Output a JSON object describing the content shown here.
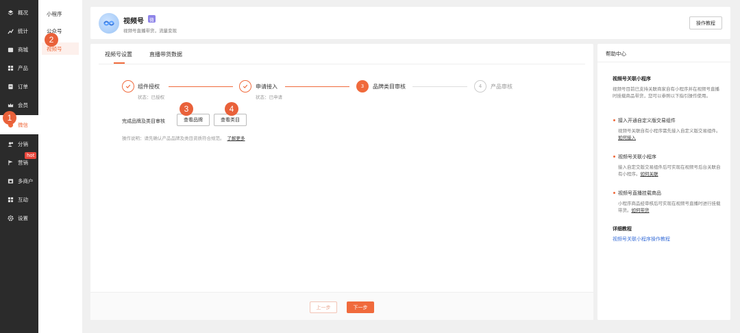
{
  "sidebar": {
    "items": [
      {
        "label": "概况",
        "icon": "layers-icon"
      },
      {
        "label": "统计",
        "icon": "chart-icon"
      },
      {
        "label": "商城",
        "icon": "store-icon"
      },
      {
        "label": "产品",
        "icon": "grid-icon"
      },
      {
        "label": "订单",
        "icon": "order-icon"
      },
      {
        "label": "会员",
        "icon": "crown-icon"
      },
      {
        "label": "微信",
        "icon": "wechat-icon"
      },
      {
        "label": "分销",
        "icon": "users-icon"
      },
      {
        "label": "营销",
        "icon": "flag-icon"
      },
      {
        "label": "多商户",
        "icon": "shop-icon"
      },
      {
        "label": "互动",
        "icon": "apps-icon"
      },
      {
        "label": "设置",
        "icon": "gear-icon"
      }
    ],
    "hot_badge": "hot",
    "accent": "#f06a3c"
  },
  "submenu": {
    "items": [
      {
        "label": "小程序"
      },
      {
        "label": "公众号"
      },
      {
        "label": "视频号"
      }
    ]
  },
  "annotations": [
    "1",
    "2",
    "3",
    "4"
  ],
  "header": {
    "title": "视频号",
    "tag": "微",
    "subtitle": "视频号直播带货，流量变现",
    "tutorial_button": "操作教程"
  },
  "tabs": [
    {
      "label": "视频号设置"
    },
    {
      "label": "直播带货数据"
    }
  ],
  "steps": [
    {
      "index": "1",
      "label": "组件授权",
      "status": "状态：已授权"
    },
    {
      "index": "2",
      "label": "申请接入",
      "status": "状态：已申请"
    },
    {
      "index": "3",
      "label": "品牌类目审核",
      "status": ""
    },
    {
      "index": "4",
      "label": "产品审核",
      "status": ""
    }
  ],
  "review": {
    "label": "完成品牌及类目审核",
    "brand_button": "查看品牌",
    "category_button": "查看类目"
  },
  "note": {
    "text": "操作说明：请先确认产品品牌及类目资质符合规范。",
    "link": "了解更多"
  },
  "footer": {
    "prev": "上一步",
    "next": "下一步"
  },
  "help": {
    "title": "帮助中心",
    "section1_title": "视频号关联小程序",
    "section1_text": "视频号目前已支持关联商家自有小程序并在视频号直播时挂载商品带货，您可以参照以下指引操作使用。",
    "item1_title": "接入开通自定义版交易组件",
    "item1_text": "视频号关联自有小程序需先接入自定义版交易组件。",
    "item1_link": "如何接入",
    "item2_title": "视频号关联小程序",
    "item2_text": "接入自定交版交易组件后可实现在视频号后台关联自有小程序。",
    "item2_link": "如何关联",
    "item3_title": "视频号直播挂载商品",
    "item3_text": "小程序商品经审核后可实现在视频号直播时进行挂载带货。",
    "item3_link": "如何带货",
    "detail_title": "详细教程",
    "detail_link": "视频号关联小程序操作教程"
  }
}
